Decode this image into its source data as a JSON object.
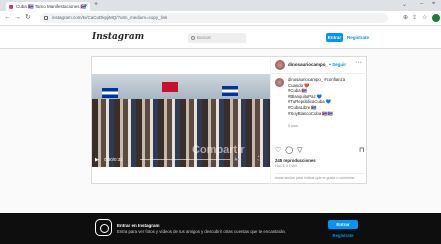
{
  "browser": {
    "tab_title": "Cuba 🇨🇺 Tamo Manifestaciones 🇨🇺",
    "url": "instagram.com/tv/CaCuDkpjiMQ/?utm_medium=copy_link",
    "new_tab": "+"
  },
  "header": {
    "logo": "Instagram",
    "search_placeholder": "Buscar",
    "login_label": "Entrar",
    "signup_label": "Regístrate"
  },
  "post": {
    "username": "dinosauriocampo_",
    "follow_label": "Seguir",
    "more": "···",
    "caption_lines": [
      "dinosauriocampo_ #confianza",
      "Cuando ❤️",
      "#Cuba 🇨🇺",
      "#BlanquitoPaz 💙",
      "#TuRepúblicaCuba 💙",
      "#CubaLibre 🇨🇺",
      "#SoyBlancoCuba 🇨🇺🇨🇺"
    ],
    "caption_age": "5 sem",
    "video_time": "0:30/0:31",
    "watermark": "Compartir",
    "views": "245 reproducciones",
    "date": "HACE 5 DÍAS",
    "login_hint": "Inicia sesión para indicar que te gusta o comentar."
  },
  "banner": {
    "title": "Entrar en Instagram",
    "text": "Entra para ver fotos y vídeos de tus amigos y descubrir otras cuentas que te encantarán.",
    "login_label": "Entrar",
    "signup_label": "Regístrate"
  }
}
